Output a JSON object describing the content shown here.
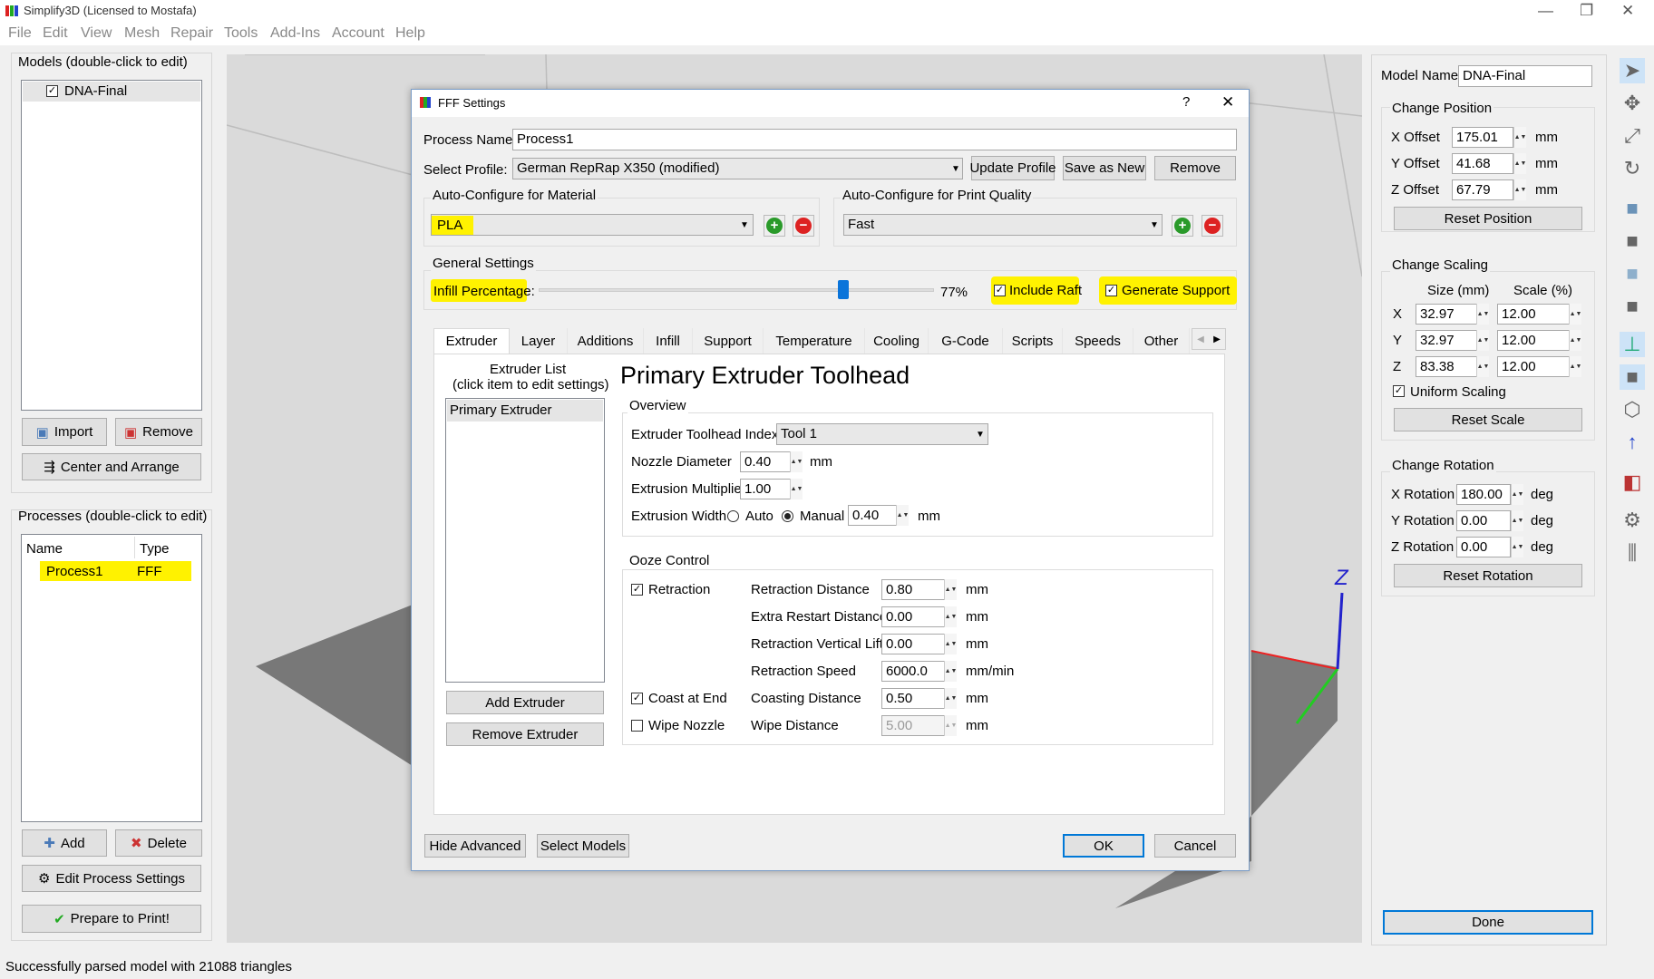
{
  "app": {
    "title": "Simplify3D (Licensed to Mostafa)",
    "menu": [
      "File",
      "Edit",
      "View",
      "Mesh",
      "Repair",
      "Tools",
      "Add-Ins",
      "Account",
      "Help"
    ]
  },
  "models": {
    "header": "Models (double-click to edit)",
    "items": [
      {
        "name": "DNA-Final",
        "checked": true
      }
    ],
    "import": "Import",
    "remove": "Remove",
    "center": "Center and Arrange"
  },
  "processes": {
    "header": "Processes (double-click to edit)",
    "col_name": "Name",
    "col_type": "Type",
    "rows": [
      {
        "name": "Process1",
        "type": "FFF"
      }
    ],
    "add": "Add",
    "delete": "Delete",
    "edit": "Edit Process Settings",
    "prepare": "Prepare to Print!"
  },
  "status": "Successfully parsed model with 21088 triangles",
  "right": {
    "model_name_label": "Model Name:",
    "model_name": "DNA-Final",
    "position": {
      "title": "Change Position",
      "x_label": "X Offset",
      "x": "175.01",
      "y_label": "Y Offset",
      "y": "41.68",
      "z_label": "Z Offset",
      "z": "67.79",
      "unit": "mm",
      "reset": "Reset Position"
    },
    "scaling": {
      "title": "Change Scaling",
      "size_h": "Size (mm)",
      "scale_h": "Scale (%)",
      "rows": [
        {
          "axis": "X",
          "size": "32.97",
          "scale": "12.00"
        },
        {
          "axis": "Y",
          "size": "32.97",
          "scale": "12.00"
        },
        {
          "axis": "Z",
          "size": "83.38",
          "scale": "12.00"
        }
      ],
      "uniform": "Uniform Scaling",
      "reset": "Reset Scale"
    },
    "rotation": {
      "title": "Change Rotation",
      "x_label": "X Rotation",
      "x": "180.00",
      "y_label": "Y Rotation",
      "y": "0.00",
      "z_label": "Z Rotation",
      "z": "0.00",
      "unit": "deg",
      "reset": "Reset Rotation"
    },
    "done": "Done"
  },
  "dialog": {
    "title": "FFF Settings",
    "help": "?",
    "close": "✕",
    "process_name_label": "Process Name:",
    "process_name": "Process1",
    "profile_label": "Select Profile:",
    "profile": "German RepRap X350 (modified)",
    "update_profile": "Update Profile",
    "save_as_new": "Save as New",
    "remove": "Remove",
    "material_title": "Auto-Configure for Material",
    "material": "PLA",
    "quality_title": "Auto-Configure for Print Quality",
    "quality": "Fast",
    "general_title": "General Settings",
    "infill_label": "Infill Percentage:",
    "infill_value": "77%",
    "infill_fraction": 0.77,
    "include_raft": "Include Raft",
    "generate_support": "Generate Support",
    "tabs": [
      "Extruder",
      "Layer",
      "Additions",
      "Infill",
      "Support",
      "Temperature",
      "Cooling",
      "G-Code",
      "Scripts",
      "Speeds",
      "Other"
    ],
    "extruder_list_title": "Extruder List",
    "extruder_list_sub": "(click item to edit settings)",
    "extruders": [
      "Primary Extruder"
    ],
    "add_extruder": "Add Extruder",
    "remove_extruder": "Remove Extruder",
    "heading": "Primary Extruder Toolhead",
    "overview": {
      "title": "Overview",
      "toolhead_label": "Extruder Toolhead Index",
      "toolhead": "Tool 1",
      "nozzle_label": "Nozzle Diameter",
      "nozzle": "0.40",
      "mult_label": "Extrusion Multiplier",
      "mult": "1.00",
      "width_label": "Extrusion Width",
      "auto": "Auto",
      "manual": "Manual",
      "width": "0.40",
      "mm": "mm"
    },
    "ooze": {
      "title": "Ooze Control",
      "retraction": "Retraction",
      "coast": "Coast at End",
      "wipe": "Wipe Nozzle",
      "fields": [
        {
          "label": "Retraction Distance",
          "value": "0.80",
          "unit": "mm"
        },
        {
          "label": "Extra Restart Distance",
          "value": "0.00",
          "unit": "mm"
        },
        {
          "label": "Retraction Vertical Lift",
          "value": "0.00",
          "unit": "mm"
        },
        {
          "label": "Retraction Speed",
          "value": "6000.0",
          "unit": "mm/min"
        },
        {
          "label": "Coasting Distance",
          "value": "0.50",
          "unit": "mm"
        },
        {
          "label": "Wipe Distance",
          "value": "5.00",
          "unit": "mm"
        }
      ]
    },
    "hide_advanced": "Hide Advanced",
    "select_models": "Select Models",
    "ok": "OK",
    "cancel": "Cancel"
  },
  "colors": {
    "highlight": "#fff200",
    "accent": "#0078d7"
  }
}
